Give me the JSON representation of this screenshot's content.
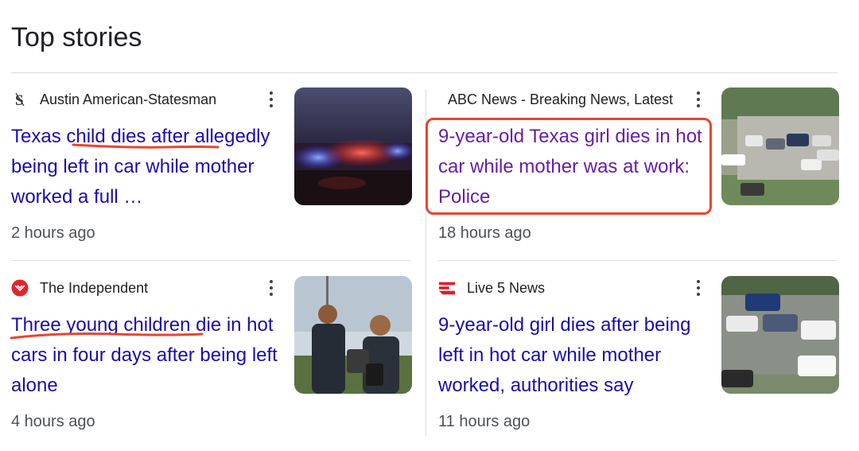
{
  "section": {
    "title": "Top stories"
  },
  "stories": [
    {
      "source": "Austin American-Statesman",
      "source_icon": "statesman-logo-icon",
      "headline": "Texas child dies after allegedly being left in car while mother worked a full …",
      "time": "2 hours ago",
      "thumbnail": "police-lights-image",
      "visited": false
    },
    {
      "source": "ABC News - Breaking News, Latest",
      "source_icon": "abc-news-logo-icon",
      "headline": "9-year-old Texas girl dies in hot car while mother was at work: Police",
      "time": "18 hours ago",
      "thumbnail": "aerial-parking-lot-image",
      "visited": true
    },
    {
      "source": "The Independent",
      "source_icon": "independent-eagle-icon",
      "headline": "Three young children die in hot cars in four days after being left alone",
      "time": "4 hours ago",
      "thumbnail": "officers-press-conference-image",
      "visited": false
    },
    {
      "source": "Live 5 News",
      "source_icon": "live5-logo-icon",
      "headline": "9-year-old girl dies after being left in hot car while mother worked, authorities say",
      "time": "11 hours ago",
      "thumbnail": "aerial-police-cars-image",
      "visited": false
    }
  ],
  "colors": {
    "link": "#1a0dab",
    "visited_link": "#681da8",
    "annotation": "#e8452c"
  }
}
